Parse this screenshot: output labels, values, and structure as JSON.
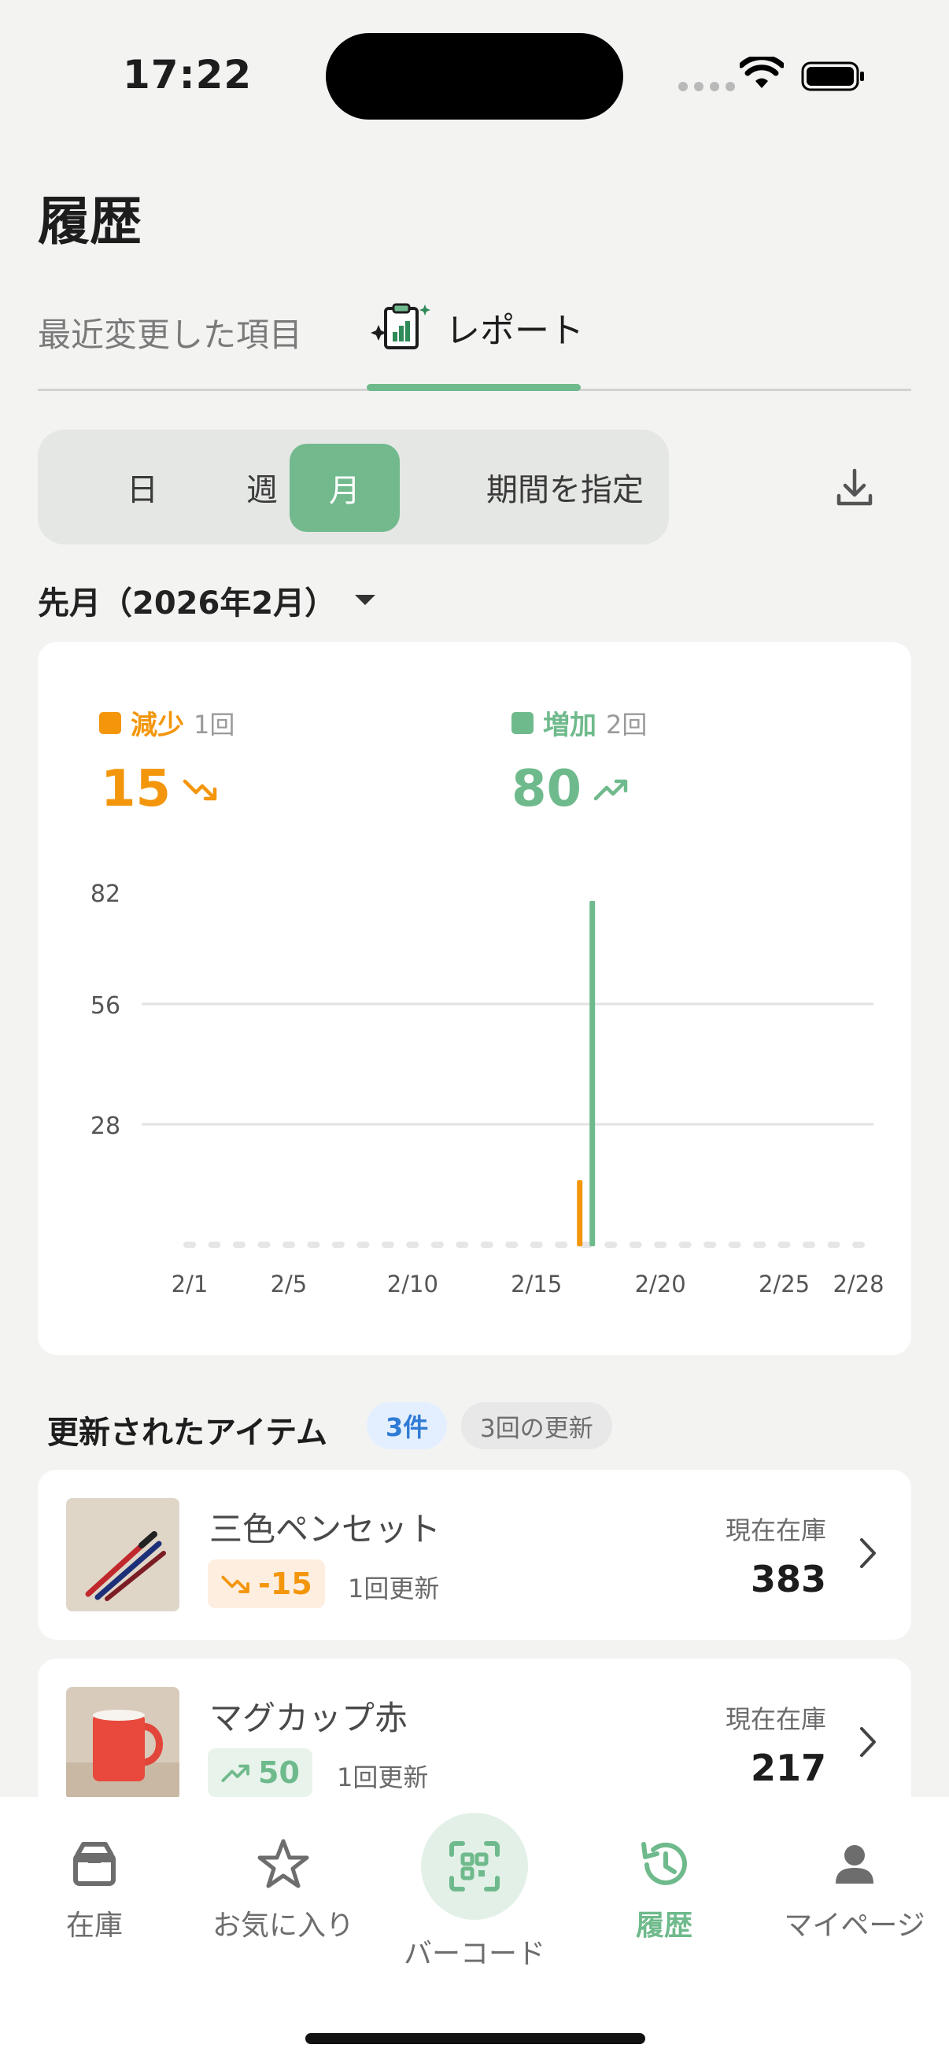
{
  "status": {
    "time": "17:22"
  },
  "header": {
    "title": "履歴"
  },
  "tabs": {
    "recent": "最近変更した項目",
    "report": "レポート"
  },
  "segment": {
    "day": "日",
    "week": "週",
    "month": "月",
    "custom": "期間を指定",
    "selected": "月"
  },
  "period": {
    "label": "先月（2026年2月）"
  },
  "legend": {
    "decrease": {
      "label": "減少",
      "count": "1回",
      "total": "15",
      "color": "#f3960c"
    },
    "increase": {
      "label": "増加",
      "count": "2回",
      "total": "80",
      "color": "#6fba8c"
    }
  },
  "chart_data": {
    "type": "bar",
    "x_labels": [
      "2/1",
      "2/5",
      "2/10",
      "2/15",
      "2/20",
      "2/25",
      "2/28"
    ],
    "x_label_days": [
      1,
      5,
      10,
      15,
      20,
      25,
      28
    ],
    "y_ticks": [
      28,
      56,
      82
    ],
    "ylim": [
      0,
      82
    ],
    "days": 28,
    "series": [
      {
        "name": "減少",
        "color": "#f3960c",
        "points": [
          {
            "day": 17,
            "value": 15
          }
        ]
      },
      {
        "name": "増加",
        "color": "#6fba8c",
        "points": [
          {
            "day": 17,
            "value": 80
          }
        ]
      }
    ]
  },
  "items_section": {
    "title": "更新されたアイテム",
    "count_badge": "3件",
    "updates_badge": "3回の更新"
  },
  "items": [
    {
      "name": "三色ペンセット",
      "delta": "-15",
      "delta_type": "decrease",
      "updates": "1回更新",
      "stock_label": "現在在庫",
      "stock": "383"
    },
    {
      "name": "マグカップ赤",
      "delta": "50",
      "delta_type": "increase",
      "updates": "1回更新",
      "stock_label": "現在在庫",
      "stock": "217"
    }
  ],
  "nav": {
    "stock": "在庫",
    "favorites": "お気に入り",
    "barcode": "バーコード",
    "history": "履歴",
    "mypage": "マイページ"
  }
}
